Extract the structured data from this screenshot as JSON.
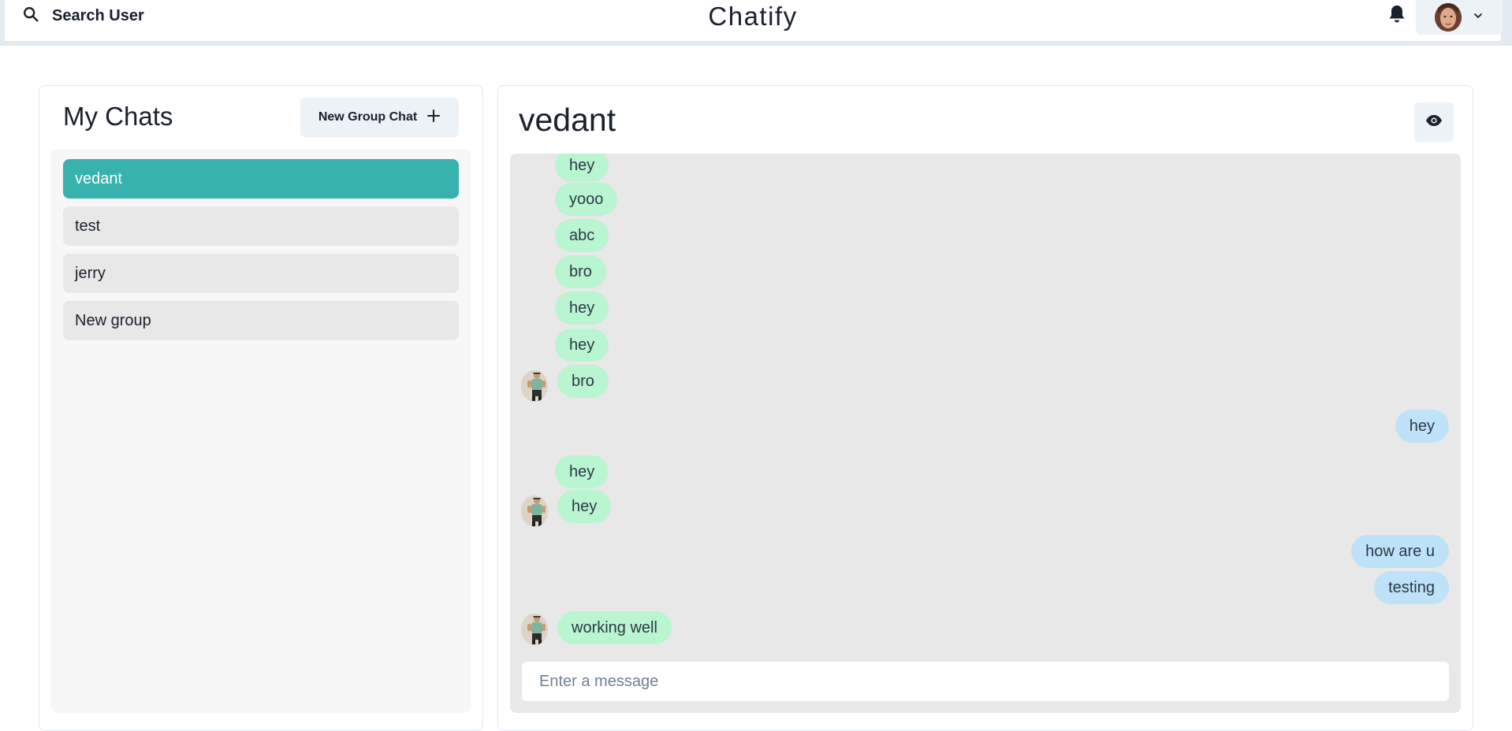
{
  "header": {
    "search_label": "Search User",
    "app_title": "Chatify"
  },
  "chats": {
    "title": "My Chats",
    "new_group_label": "New Group Chat",
    "items": [
      {
        "label": "vedant",
        "active": true
      },
      {
        "label": "test",
        "active": false
      },
      {
        "label": "jerry",
        "active": false
      },
      {
        "label": "New group",
        "active": false
      }
    ]
  },
  "conversation": {
    "name": "vedant",
    "messages": [
      {
        "text": "hey",
        "direction": "in"
      },
      {
        "text": "yooo",
        "direction": "in"
      },
      {
        "text": "abc",
        "direction": "in"
      },
      {
        "text": "bro",
        "direction": "in"
      },
      {
        "text": "hey",
        "direction": "in"
      },
      {
        "text": "hey",
        "direction": "in"
      },
      {
        "text": "bro",
        "direction": "in",
        "avatar": true
      },
      {
        "text": "hey",
        "direction": "out"
      },
      {
        "text": "hey",
        "direction": "in"
      },
      {
        "text": "hey",
        "direction": "in",
        "avatar": true
      },
      {
        "text": "how are u",
        "direction": "out"
      },
      {
        "text": "testing",
        "direction": "out"
      },
      {
        "text": "working well",
        "direction": "in",
        "avatar": true
      }
    ],
    "input_placeholder": "Enter a message",
    "input_value": ""
  },
  "colors": {
    "accent": "#38b2ac",
    "incoming_bubble": "#b9f5d0",
    "outgoing_bubble": "#bee3f8"
  },
  "icons": {
    "search": "search-icon",
    "notifications": "bell-icon",
    "menu": "chevron-down-icon",
    "add": "plus-icon",
    "view_profile": "eye-icon"
  }
}
